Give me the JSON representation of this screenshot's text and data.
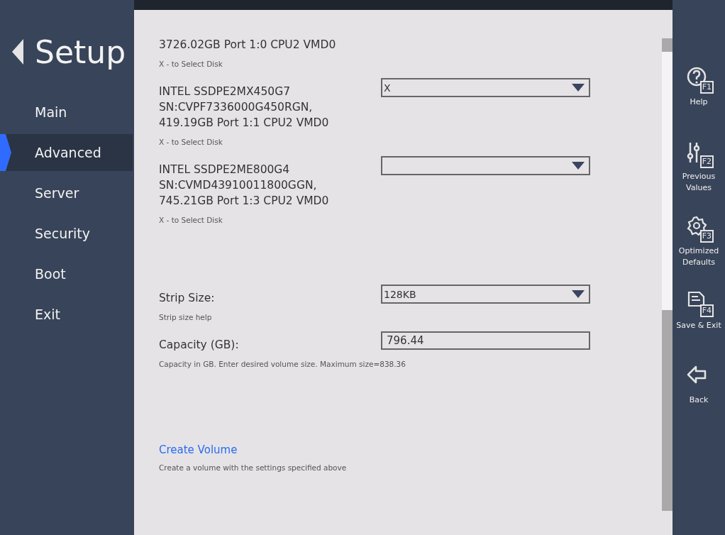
{
  "sidebar": {
    "title": "Setup",
    "items": [
      {
        "label": "Main",
        "selected": false
      },
      {
        "label": "Advanced",
        "selected": true
      },
      {
        "label": "Server",
        "selected": false
      },
      {
        "label": "Security",
        "selected": false
      },
      {
        "label": "Boot",
        "selected": false
      },
      {
        "label": "Exit",
        "selected": false
      }
    ]
  },
  "disks": [
    {
      "kind": "plain",
      "lines": [
        "3726.02GB  Port 1:0 CPU2 VMD0"
      ],
      "help": "X - to Select Disk"
    },
    {
      "kind": "select",
      "lines": [
        "INTEL SSDPE2MX450G7",
        "SN:CVPF7336000G450RGN,",
        "419.19GB  Port 1:1 CPU2 VMD0"
      ],
      "help": "X - to Select Disk",
      "value": "X"
    },
    {
      "kind": "select",
      "lines": [
        "INTEL SSDPE2ME800G4",
        "SN:CVMD43910011800GGN,",
        "745.21GB  Port 1:3 CPU2 VMD0"
      ],
      "help": "X - to Select Disk"
    }
  ],
  "settings": [
    {
      "kind": "select",
      "label": "Strip Size:",
      "value": "128KB",
      "help": "Strip size help"
    },
    {
      "kind": "input",
      "label": "Capacity (GB):",
      "value": "796.44",
      "help": "Capacity in GB. Enter desired volume size. Maximum size=838.36"
    }
  ],
  "action": {
    "label": "Create Volume",
    "help": "Create a volume with the settings specified above"
  },
  "function_keys": [
    {
      "kind": "help",
      "key": "F1",
      "label": "Help"
    },
    {
      "kind": "previous",
      "key": "F2",
      "label": "Previous Values"
    },
    {
      "kind": "defaults",
      "key": "F3",
      "label": "Optimized Defaults"
    },
    {
      "kind": "save",
      "key": "F4",
      "label": "Save & Exit"
    },
    {
      "kind": "back",
      "label": "Back"
    }
  ]
}
